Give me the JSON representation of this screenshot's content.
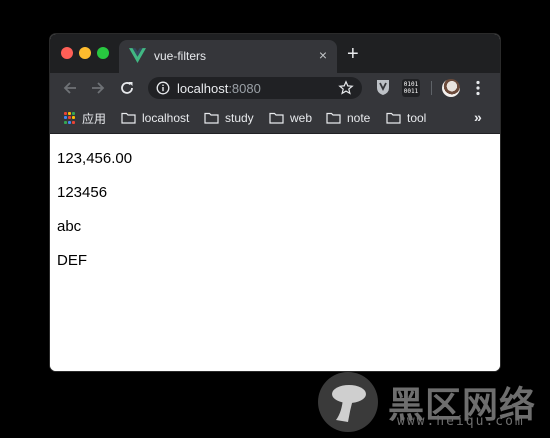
{
  "browser": {
    "tab_title": "vue-filters",
    "tab_close": "×",
    "new_tab": "+",
    "url_host": "localhost",
    "url_port": ":8080",
    "extension_binary_line1": "0101",
    "extension_binary_line2": "0011",
    "bookmarks": {
      "apps_label": "应用",
      "items": [
        "localhost",
        "study",
        "web",
        "note",
        "tool"
      ],
      "overflow": "»"
    },
    "apps_colors": [
      "#ea4335",
      "#fbbc04",
      "#34a853",
      "#4285f4",
      "#ea4335",
      "#fbbc04",
      "#34a853",
      "#4285f4",
      "#ea4335"
    ]
  },
  "page": {
    "lines": [
      "123,456.00",
      "123456",
      "abc",
      "DEF"
    ]
  },
  "watermark": {
    "brand": "黑区网络",
    "url": "www.heiqu.com"
  },
  "colors": {
    "tab_strip": "#1f2022",
    "toolbar": "#35363a",
    "vue_green": "#41b883",
    "vue_dark": "#34495e"
  }
}
